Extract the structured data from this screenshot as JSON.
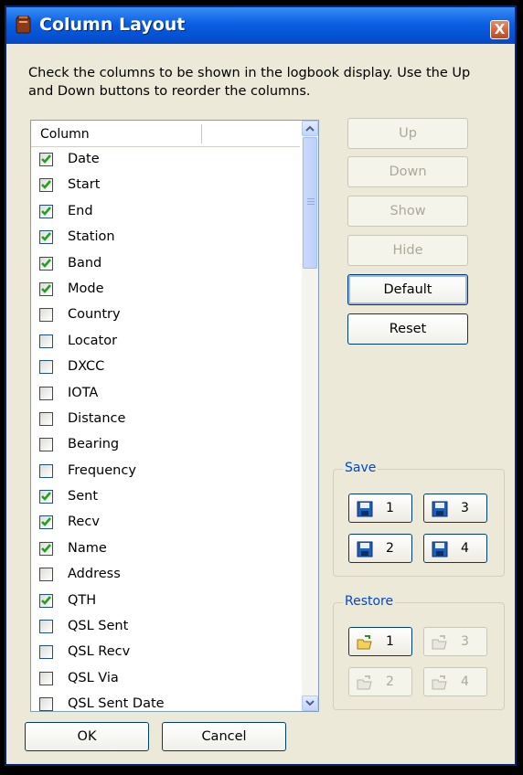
{
  "window": {
    "title": "Column Layout",
    "close_label": "X"
  },
  "instructions": "Check the columns to be shown in the logbook display. Use the Up and Down buttons to reorder the columns.",
  "list": {
    "header": "Column",
    "items": [
      {
        "label": "Date",
        "checked": true
      },
      {
        "label": "Start",
        "checked": true
      },
      {
        "label": "End",
        "checked": true
      },
      {
        "label": "Station",
        "checked": true
      },
      {
        "label": "Band",
        "checked": true
      },
      {
        "label": "Mode",
        "checked": true
      },
      {
        "label": "Country",
        "checked": false
      },
      {
        "label": "Locator",
        "checked": false
      },
      {
        "label": "DXCC",
        "checked": false
      },
      {
        "label": "IOTA",
        "checked": false
      },
      {
        "label": "Distance",
        "checked": false
      },
      {
        "label": "Bearing",
        "checked": false
      },
      {
        "label": "Frequency",
        "checked": false
      },
      {
        "label": "Sent",
        "checked": true
      },
      {
        "label": "Recv",
        "checked": true
      },
      {
        "label": "Name",
        "checked": true
      },
      {
        "label": "Address",
        "checked": false
      },
      {
        "label": "QTH",
        "checked": true
      },
      {
        "label": "QSL Sent",
        "checked": false
      },
      {
        "label": "QSL Recv",
        "checked": false
      },
      {
        "label": "QSL Via",
        "checked": false
      },
      {
        "label": "QSL Sent Date",
        "checked": false
      }
    ]
  },
  "buttons": {
    "up": "Up",
    "down": "Down",
    "show": "Show",
    "hide": "Hide",
    "default": "Default",
    "reset": "Reset",
    "ok": "OK",
    "cancel": "Cancel"
  },
  "save": {
    "label": "Save",
    "slots": [
      "1",
      "3",
      "2",
      "4"
    ]
  },
  "restore": {
    "label": "Restore",
    "slots": [
      "1",
      "3",
      "2",
      "4"
    ]
  },
  "colors": {
    "title_bar": "#0A5FE3",
    "check": "#21A121",
    "group_label": "#0046D5"
  }
}
